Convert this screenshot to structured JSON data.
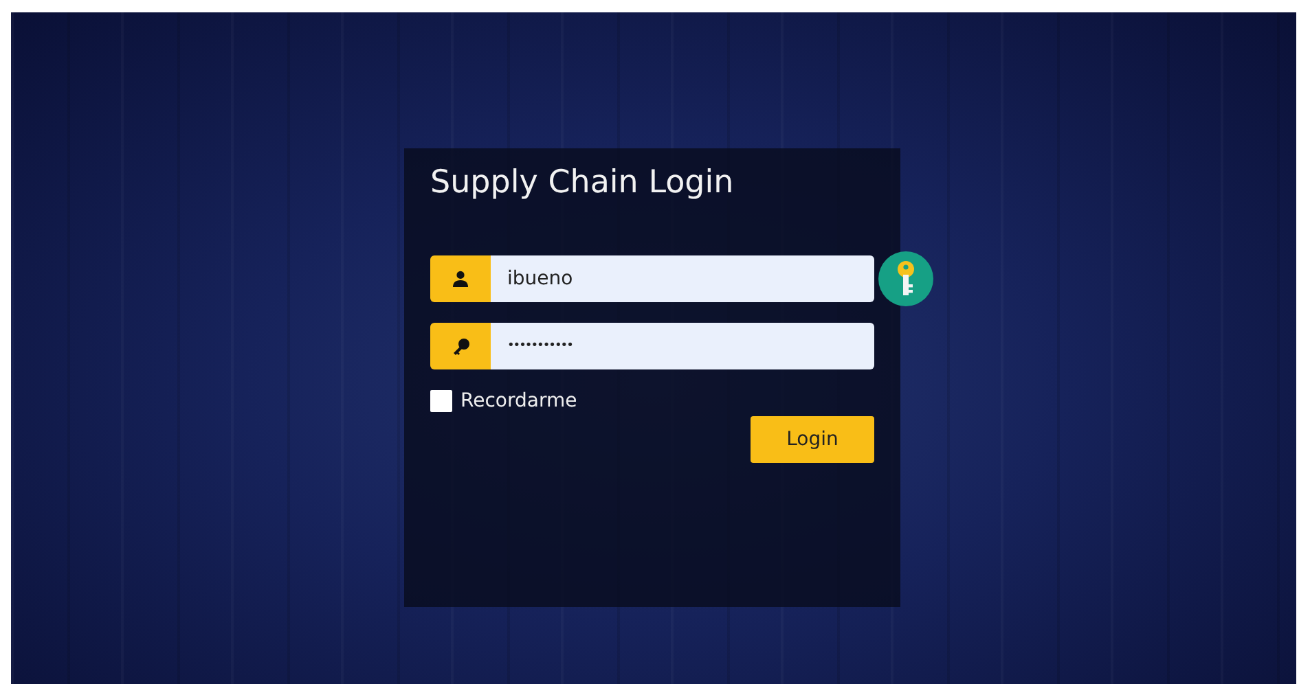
{
  "login": {
    "title": "Supply Chain Login",
    "username": {
      "value": "ibueno"
    },
    "password": {
      "value": "•••••••••••"
    },
    "remember": {
      "label": "Recordarme",
      "checked": false
    },
    "button": "Login"
  }
}
